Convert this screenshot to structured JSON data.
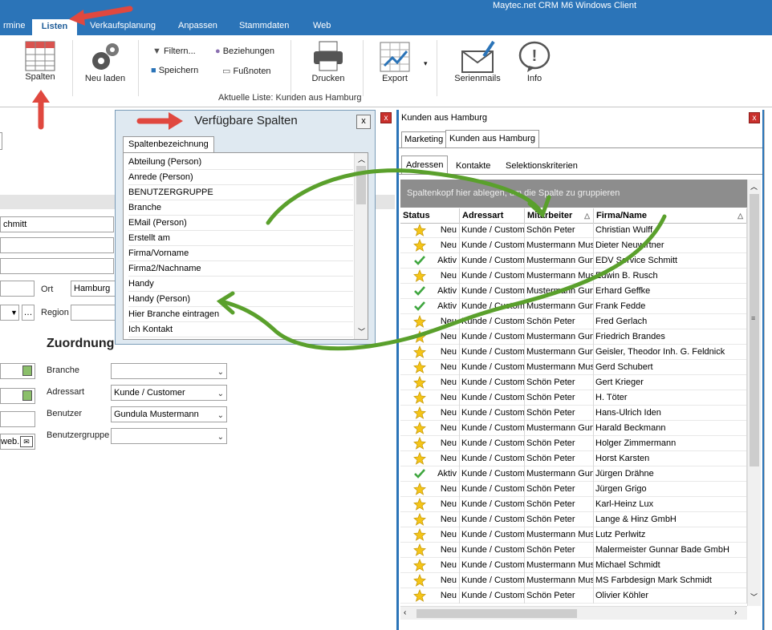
{
  "app": {
    "title": "Maytec.net CRM M6 Windows Client"
  },
  "tabs": [
    {
      "label": "rmine"
    },
    {
      "label": "Listen",
      "active": true
    },
    {
      "label": "Verkaufsplanung"
    },
    {
      "label": "Anpassen"
    },
    {
      "label": "Stammdaten"
    },
    {
      "label": "Web"
    }
  ],
  "ribbon": {
    "spalten": "Spalten",
    "neu_laden": "Neu laden",
    "filtern": "Filtern...",
    "speichern": "Speichern",
    "beziehungen": "Beziehungen",
    "fussnoten": "Fußnoten",
    "drucken": "Drucken",
    "export": "Export",
    "serienmails": "Serienmails",
    "info": "Info",
    "group_label": "Aktuelle Liste: Kunden aus Hamburg"
  },
  "left": {
    "name_value": "chmitt",
    "ort_label": "Ort",
    "ort_value": "Hamburg",
    "region_label": "Region",
    "zuordnung": "Zuordnung",
    "branche_label": "Branche",
    "branche_value": "",
    "adressart_label": "Adressart",
    "adressart_value": "Kunde / Customer",
    "benutzer_label": "Benutzer",
    "benutzer_value": "Gundula Mustermann",
    "benutzergruppe_label": "Benutzergruppe",
    "benutzergruppe_value": "",
    "web_text": "web."
  },
  "popup": {
    "title": "Verfügbare Spalten",
    "close": "x",
    "tab": "Spaltenbezeichnung",
    "items": [
      "Abteilung (Person)",
      "Anrede (Person)",
      "BENUTZERGRUPPE",
      "Branche",
      "EMail (Person)",
      "Erstellt am",
      "Firma/Vorname",
      "Firma2/Nachname",
      "Handy",
      "Handy (Person)",
      "Hier Branche eintragen",
      "Ich Kontakt"
    ]
  },
  "list": {
    "title": "Kunden aus Hamburg",
    "close": "x",
    "subtabs": [
      "Marketing",
      "Kunden aus Hamburg"
    ],
    "tabs": [
      "Adressen",
      "Kontakte",
      "Selektionskriterien"
    ],
    "group_hint": "Spaltenkopf hier ablegen, um die Spalte zu gruppieren",
    "columns": [
      "Status",
      "Adressart",
      "Mitarbeiter",
      "Firma/Name"
    ],
    "rows": [
      {
        "icon": "star",
        "status": "Neu",
        "adressart": "Kunde / Customer",
        "mitarbeiter": "Schön Peter",
        "firma": "Christian Wulff"
      },
      {
        "icon": "star",
        "status": "Neu",
        "adressart": "Kunde / Customer",
        "mitarbeiter": "Mustermann Mus",
        "firma": "Dieter Neuwirtner"
      },
      {
        "icon": "check",
        "status": "Aktiv",
        "adressart": "Kunde / Customer",
        "mitarbeiter": "Mustermann Gun",
        "firma": "EDV Service Schmitt"
      },
      {
        "icon": "star",
        "status": "Neu",
        "adressart": "Kunde / Customer",
        "mitarbeiter": "Mustermann Mus",
        "firma": "Edwin B. Rusch"
      },
      {
        "icon": "check",
        "status": "Aktiv",
        "adressart": "Kunde / Customer",
        "mitarbeiter": "Mustermann Gun",
        "firma": "Erhard Geffke"
      },
      {
        "icon": "check",
        "status": "Aktiv",
        "adressart": "Kunde / Customer",
        "mitarbeiter": "Mustermann Gun",
        "firma": "Frank Fedde"
      },
      {
        "icon": "star",
        "status": "Neu",
        "adressart": "Kunde / Customer",
        "mitarbeiter": "Schön Peter",
        "firma": "Fred Gerlach"
      },
      {
        "icon": "star",
        "status": "Neu",
        "adressart": "Kunde / Customer",
        "mitarbeiter": "Mustermann Gun",
        "firma": "Friedrich Brandes"
      },
      {
        "icon": "star",
        "status": "Neu",
        "adressart": "Kunde / Customer",
        "mitarbeiter": "Mustermann Gun",
        "firma": "Geisler, Theodor Inh. G. Feldnick"
      },
      {
        "icon": "star",
        "status": "Neu",
        "adressart": "Kunde / Customer",
        "mitarbeiter": "Mustermann Mus",
        "firma": "Gerd Schubert"
      },
      {
        "icon": "star",
        "status": "Neu",
        "adressart": "Kunde / Customer",
        "mitarbeiter": "Schön Peter",
        "firma": "Gert Krieger"
      },
      {
        "icon": "star",
        "status": "Neu",
        "adressart": "Kunde / Customer",
        "mitarbeiter": "Schön Peter",
        "firma": "H. Töter"
      },
      {
        "icon": "star",
        "status": "Neu",
        "adressart": "Kunde / Customer",
        "mitarbeiter": "Schön Peter",
        "firma": "Hans-Ulrich Iden"
      },
      {
        "icon": "star",
        "status": "Neu",
        "adressart": "Kunde / Customer",
        "mitarbeiter": "Mustermann Gun",
        "firma": "Harald Beckmann"
      },
      {
        "icon": "star",
        "status": "Neu",
        "adressart": "Kunde / Customer",
        "mitarbeiter": "Schön Peter",
        "firma": "Holger Zimmermann"
      },
      {
        "icon": "star",
        "status": "Neu",
        "adressart": "Kunde / Customer",
        "mitarbeiter": "Schön Peter",
        "firma": "Horst Karsten"
      },
      {
        "icon": "check",
        "status": "Aktiv",
        "adressart": "Kunde / Customer",
        "mitarbeiter": "Mustermann Gun",
        "firma": "Jürgen Drähne"
      },
      {
        "icon": "star",
        "status": "Neu",
        "adressart": "Kunde / Customer",
        "mitarbeiter": "Schön Peter",
        "firma": "Jürgen Grigo"
      },
      {
        "icon": "star",
        "status": "Neu",
        "adressart": "Kunde / Customer",
        "mitarbeiter": "Schön Peter",
        "firma": "Karl-Heinz Lux"
      },
      {
        "icon": "star",
        "status": "Neu",
        "adressart": "Kunde / Customer",
        "mitarbeiter": "Schön Peter",
        "firma": "Lange & Hinz GmbH"
      },
      {
        "icon": "star",
        "status": "Neu",
        "adressart": "Kunde / Customer",
        "mitarbeiter": "Mustermann Mus",
        "firma": "Lutz Perlwitz"
      },
      {
        "icon": "star",
        "status": "Neu",
        "adressart": "Kunde / Customer",
        "mitarbeiter": "Schön Peter",
        "firma": "Malermeister Gunnar Bade GmbH"
      },
      {
        "icon": "star",
        "status": "Neu",
        "adressart": "Kunde / Customer",
        "mitarbeiter": "Mustermann Mus",
        "firma": "Michael Schmidt"
      },
      {
        "icon": "star",
        "status": "Neu",
        "adressart": "Kunde / Customer",
        "mitarbeiter": "Mustermann Mus",
        "firma": "MS Farbdesign Mark Schmidt"
      },
      {
        "icon": "star",
        "status": "Neu",
        "adressart": "Kunde / Customer",
        "mitarbeiter": "Schön Peter",
        "firma": "Olivier Köhler"
      }
    ]
  },
  "colors": {
    "accent": "#2b74b8",
    "annotation_green": "#5aa02c",
    "annotation_red": "#e0483f"
  }
}
